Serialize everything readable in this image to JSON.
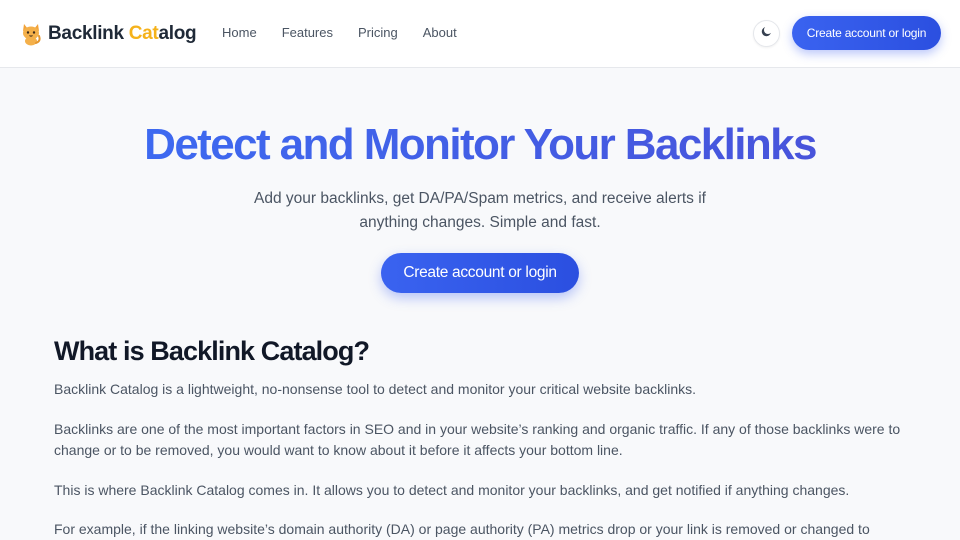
{
  "header": {
    "brand": {
      "part1": "Backlink ",
      "accent": "Cat",
      "part2": "alog",
      "icon": "cat-icon"
    },
    "nav": [
      {
        "label": "Home"
      },
      {
        "label": "Features"
      },
      {
        "label": "Pricing"
      },
      {
        "label": "About"
      }
    ],
    "theme_toggle_icon": "moon-icon",
    "cta_label": "Create account or login"
  },
  "hero": {
    "title": "Detect and Monitor Your Backlinks",
    "subtitle": "Add your backlinks, get DA/PA/Spam metrics, and receive alerts if anything changes. Simple and fast.",
    "cta_label": "Create account or login"
  },
  "about": {
    "title": "What is Backlink Catalog?",
    "paragraphs": [
      "Backlink Catalog is a lightweight, no-nonsense tool to detect and monitor your critical website backlinks.",
      "Backlinks are one of the most important factors in SEO and in your website’s ranking and organic traffic. If any of those backlinks were to change or to be removed, you would want to know about it before it affects your bottom line.",
      "This is where Backlink Catalog comes in. It allows you to detect and monitor your backlinks, and get notified if anything changes.",
      "For example, if the linking website’s domain authority (DA) or page authority (PA) metrics drop or your link is removed or changed to"
    ]
  },
  "colors": {
    "primary": "#3a5ff0",
    "brand_accent": "#f5b21b",
    "heading": "#111827",
    "body_text": "#4b5563",
    "background": "#f8f9fb"
  }
}
